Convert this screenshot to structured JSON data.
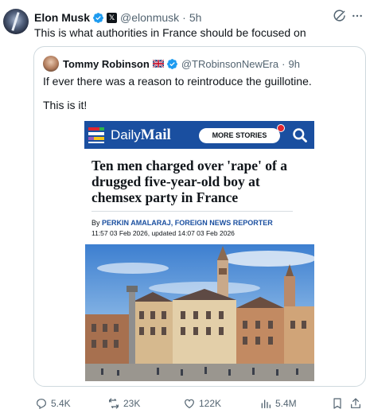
{
  "tweet": {
    "author_name": "Elon Musk",
    "handle": "@elonmusk",
    "separator": "·",
    "time": "5h",
    "text": "This is what authorities in France should be focused on"
  },
  "quoted_tweet": {
    "author_name": "Tommy Robinson",
    "handle": "@TRobinsonNewEra",
    "separator": "·",
    "time": "9h",
    "line1": "If ever there was a reason to reintroduce the guillotine.",
    "line2": "This is it!"
  },
  "article": {
    "logo_daily": "Daily",
    "logo_mail": "Mail",
    "more_stories": "MORE STORIES",
    "headline": "Ten men charged over 'rape' of a drugged five-year-old boy at chemsex party in France",
    "byline_prefix": "By",
    "byline_name": "PERKIN AMALARAJ, FOREIGN NEWS REPORTER",
    "date_line": "11:57 03 Feb 2026, updated 14:07 03 Feb 2026"
  },
  "actions": {
    "replies": "5.4K",
    "reposts": "23K",
    "likes": "122K",
    "views": "5.4M"
  },
  "colors": {
    "verified_blue": "#1d9bf0",
    "muted_text": "#536471",
    "daily_mail_blue": "#1a4fa0",
    "notification_red": "#e0262f"
  },
  "icons": {
    "more": "more-icon",
    "grok": "grok-icon",
    "reply": "reply-icon",
    "repost": "repost-icon",
    "like": "heart-icon",
    "views": "views-icon",
    "bookmark": "bookmark-icon",
    "share": "share-icon"
  }
}
